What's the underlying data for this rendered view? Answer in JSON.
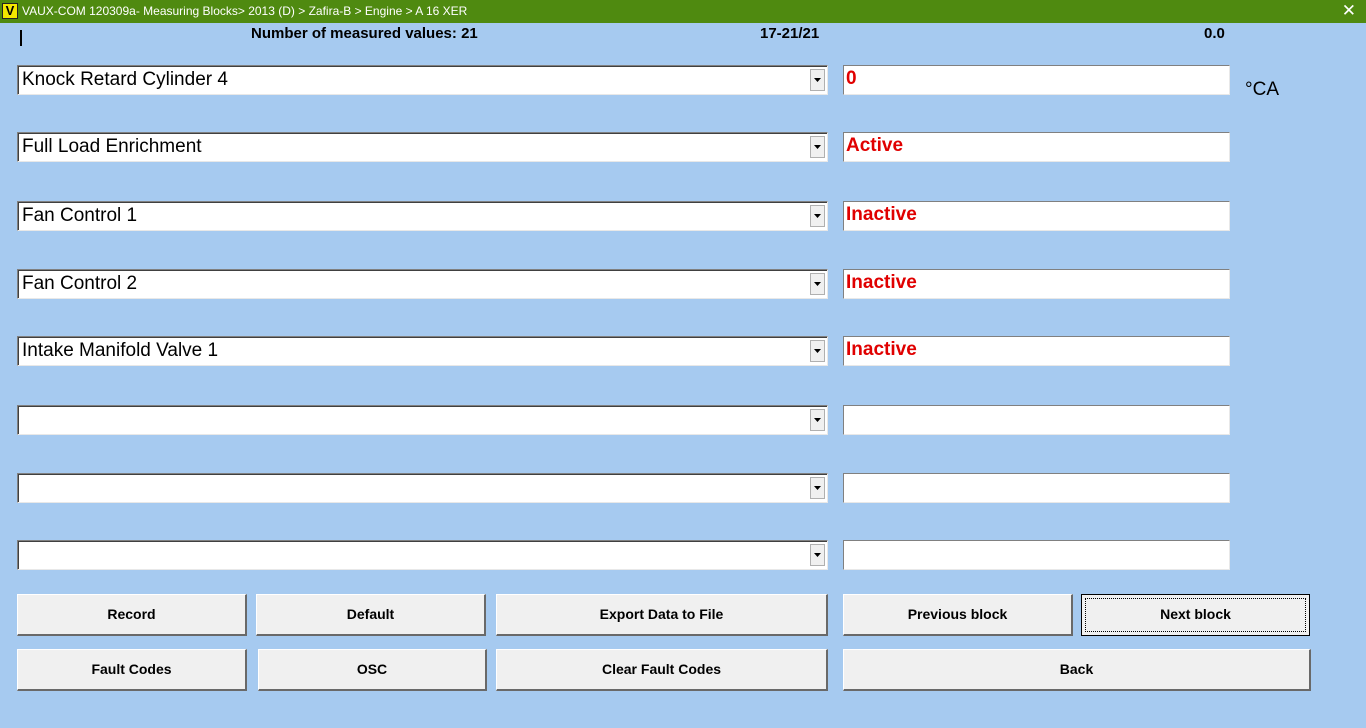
{
  "window": {
    "title": "VAUX-COM 120309a- Measuring Blocks> 2013 (D) > Zafira-B > Engine > A 16 XER",
    "app_icon_letter": "V",
    "close_glyph": "✕"
  },
  "header": {
    "measured_values": "Number of measured values: 21",
    "range": "17-21/21",
    "time_value": "0.0"
  },
  "rows": [
    {
      "label": "Knock Retard Cylinder 4",
      "value": "0"
    },
    {
      "label": "Full Load Enrichment",
      "value": "Active"
    },
    {
      "label": "Fan Control 1",
      "value": "Inactive"
    },
    {
      "label": "Fan Control 2",
      "value": "Inactive"
    },
    {
      "label": "Intake Manifold Valve 1",
      "value": "Inactive"
    },
    {
      "label": "",
      "value": ""
    },
    {
      "label": "",
      "value": ""
    },
    {
      "label": "",
      "value": ""
    }
  ],
  "unit_label": "°CA",
  "buttons": {
    "record": "Record",
    "default": "Default",
    "export": "Export Data to File",
    "previous": "Previous block",
    "next": "Next block",
    "fault_codes": "Fault Codes",
    "osc": "OSC",
    "clear_fault_codes": "Clear Fault Codes",
    "back": "Back"
  },
  "colors": {
    "background": "#a6caf0",
    "titlebar": "#4f8a10",
    "value_text": "#e00000"
  }
}
